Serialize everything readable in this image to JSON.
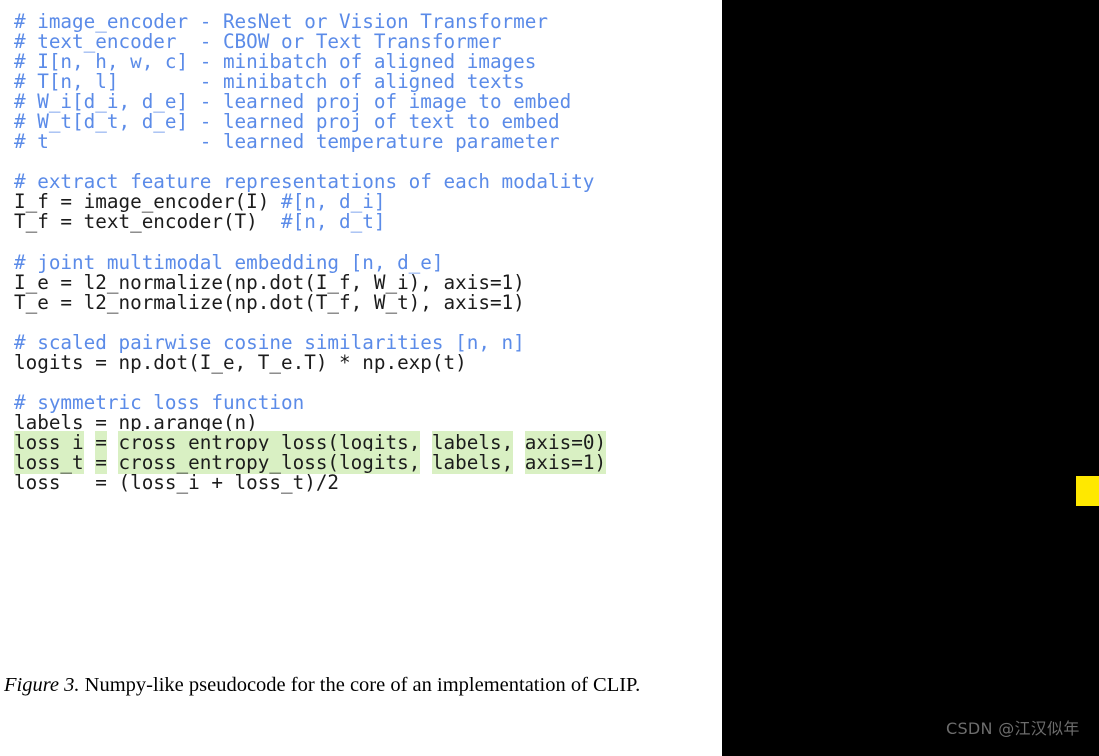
{
  "figure": {
    "caption_label": "Figure 3.",
    "caption_text": " Numpy-like pseudocode for the core of an implementation of CLIP."
  },
  "watermark": {
    "text": "CSDN @江汉似年"
  },
  "colors": {
    "comment_blue": "#5b8be8",
    "code_black": "#1c1c1c",
    "highlight_green": "#d9f0c3",
    "panel_black": "#000000",
    "marker_yellow": "#ffe800",
    "watermark_gray": "#6d6d6d",
    "background_white": "#ffffff"
  },
  "code": {
    "language": "python-pseudocode",
    "full_text": "# image_encoder - ResNet or Vision Transformer\n# text_encoder  - CBOW or Text Transformer\n# I[n, h, w, c] - minibatch of aligned images\n# T[n, l]       - minibatch of aligned texts\n# W_i[d_i, d_e] - learned proj of image to embed\n# W_t[d_t, d_e] - learned proj of text to embed\n# t             - learned temperature parameter\n\n# extract feature representations of each modality\nI_f = image_encoder(I) #[n, d_i]\nT_f = text_encoder(T)  #[n, d_t]\n\n# joint multimodal embedding [n, d_e]\nI_e = l2_normalize(np.dot(I_f, W_i), axis=1)\nT_e = l2_normalize(np.dot(T_f, W_t), axis=1)\n\n# scaled pairwise cosine similarities [n, n]\nlogits = np.dot(I_e, T_e.T) * np.exp(t)\n\n# symmetric loss function\nlabels = np.arange(n)\nloss_i = cross_entropy_loss(logits, labels, axis=0)\nloss_t = cross_entropy_loss(logits, labels, axis=1)\nloss   = (loss_i + loss_t)/2",
    "lines": [
      {
        "id": 1,
        "segments": [
          {
            "kind": "comment",
            "text": "# image_encoder - ResNet or Vision Transformer"
          }
        ]
      },
      {
        "id": 2,
        "segments": [
          {
            "kind": "comment",
            "text": "# text_encoder  - CBOW or Text Transformer"
          }
        ]
      },
      {
        "id": 3,
        "segments": [
          {
            "kind": "comment",
            "text": "# I[n, h, w, c] - minibatch of aligned images"
          }
        ]
      },
      {
        "id": 4,
        "segments": [
          {
            "kind": "comment",
            "text": "# T[n, l]       - minibatch of aligned texts"
          }
        ]
      },
      {
        "id": 5,
        "segments": [
          {
            "kind": "comment",
            "text": "# W_i[d_i, d_e] - learned proj of image to embed"
          }
        ]
      },
      {
        "id": 6,
        "segments": [
          {
            "kind": "comment",
            "text": "# W_t[d_t, d_e] - learned proj of text to embed"
          }
        ]
      },
      {
        "id": 7,
        "segments": [
          {
            "kind": "comment",
            "text": "# t             - learned temperature parameter"
          }
        ]
      },
      {
        "id": 8,
        "segments": [
          {
            "kind": "blank",
            "text": " "
          }
        ]
      },
      {
        "id": 9,
        "segments": [
          {
            "kind": "comment",
            "text": "# extract feature representations of each modality"
          }
        ]
      },
      {
        "id": 10,
        "segments": [
          {
            "kind": "code",
            "text": "I_f = image_encoder(I) "
          },
          {
            "kind": "comment",
            "text": "#[n, d_i]"
          }
        ]
      },
      {
        "id": 11,
        "segments": [
          {
            "kind": "code",
            "text": "T_f = text_encoder(T)  "
          },
          {
            "kind": "comment",
            "text": "#[n, d_t]"
          }
        ]
      },
      {
        "id": 12,
        "segments": [
          {
            "kind": "blank",
            "text": " "
          }
        ]
      },
      {
        "id": 13,
        "segments": [
          {
            "kind": "comment",
            "text": "# joint multimodal embedding [n, d_e]"
          }
        ]
      },
      {
        "id": 14,
        "segments": [
          {
            "kind": "code",
            "text": "I_e = l2_normalize(np.dot(I_f, W_i), axis=1)"
          }
        ]
      },
      {
        "id": 15,
        "segments": [
          {
            "kind": "code",
            "text": "T_e = l2_normalize(np.dot(T_f, W_t), axis=1)"
          }
        ]
      },
      {
        "id": 16,
        "segments": [
          {
            "kind": "blank",
            "text": " "
          }
        ]
      },
      {
        "id": 17,
        "segments": [
          {
            "kind": "comment",
            "text": "# scaled pairwise cosine similarities [n, n]"
          }
        ]
      },
      {
        "id": 18,
        "segments": [
          {
            "kind": "code",
            "text": "logits = np.dot(I_e, T_e.T) * np.exp(t)"
          }
        ]
      },
      {
        "id": 19,
        "segments": [
          {
            "kind": "blank",
            "text": " "
          }
        ]
      },
      {
        "id": 20,
        "segments": [
          {
            "kind": "comment",
            "text": "# symmetric loss function"
          }
        ]
      },
      {
        "id": 21,
        "segments": [
          {
            "kind": "code",
            "text": "labels = np.arange(n)"
          }
        ]
      },
      {
        "id": 22,
        "segments": [
          {
            "kind": "code-hl",
            "text": "loss_i"
          },
          {
            "kind": "code",
            "text": " "
          },
          {
            "kind": "code-hl",
            "text": "="
          },
          {
            "kind": "code",
            "text": " "
          },
          {
            "kind": "code-hl",
            "text": "cross_entropy_loss(logits,"
          },
          {
            "kind": "code",
            "text": " "
          },
          {
            "kind": "code-hl",
            "text": "labels,"
          },
          {
            "kind": "code",
            "text": " "
          },
          {
            "kind": "code-hl",
            "text": "axis=0)"
          }
        ]
      },
      {
        "id": 23,
        "segments": [
          {
            "kind": "code-hl",
            "text": "loss_t"
          },
          {
            "kind": "code",
            "text": " "
          },
          {
            "kind": "code-hl",
            "text": "="
          },
          {
            "kind": "code",
            "text": " "
          },
          {
            "kind": "code-hl",
            "text": "cross_entropy_loss(logits,"
          },
          {
            "kind": "code",
            "text": " "
          },
          {
            "kind": "code-hl",
            "text": "labels,"
          },
          {
            "kind": "code",
            "text": " "
          },
          {
            "kind": "code-hl",
            "text": "axis=1)"
          }
        ]
      },
      {
        "id": 24,
        "segments": [
          {
            "kind": "code",
            "text": "loss   = (loss_i + loss_t)/2"
          }
        ]
      }
    ]
  }
}
